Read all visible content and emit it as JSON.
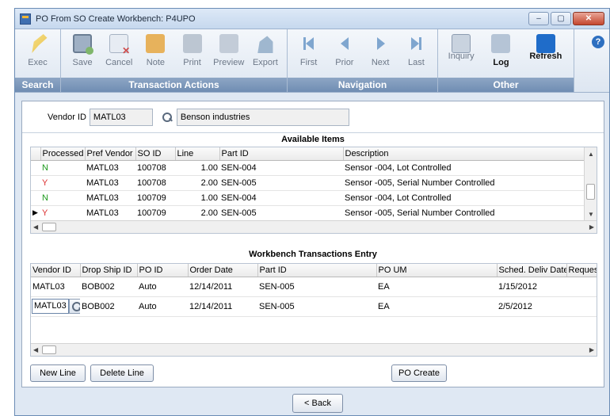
{
  "window": {
    "title": "PO From SO Create Workbench: P4UPO",
    "minimize": "–",
    "maximize": "▢",
    "close": "✕"
  },
  "ribbon": {
    "groups": [
      {
        "label": "Search",
        "tools": [
          {
            "label": "Exec",
            "icon": "exec-icon"
          }
        ]
      },
      {
        "label": "Transaction Actions",
        "tools": [
          {
            "label": "Save",
            "icon": "save-icon"
          },
          {
            "label": "Cancel",
            "icon": "cancel-icon"
          },
          {
            "label": "Note",
            "icon": "note-icon"
          },
          {
            "label": "Print",
            "icon": "print-icon"
          },
          {
            "label": "Preview",
            "icon": "preview-icon"
          },
          {
            "label": "Export",
            "icon": "export-icon"
          }
        ]
      },
      {
        "label": "Navigation",
        "tools": [
          {
            "label": "First",
            "icon": "first-icon"
          },
          {
            "label": "Prior",
            "icon": "prior-icon"
          },
          {
            "label": "Next",
            "icon": "next-icon"
          },
          {
            "label": "Last",
            "icon": "last-icon"
          }
        ]
      },
      {
        "label": "Other",
        "tools": [
          {
            "label": "Inquiry",
            "icon": "inquiry-icon"
          },
          {
            "label": "Log",
            "icon": "log-icon"
          },
          {
            "label": "Refresh",
            "icon": "refresh-icon"
          }
        ]
      }
    ],
    "help": "?"
  },
  "vendor": {
    "label": "Vendor ID",
    "id": "MATL03",
    "name": "Benson industries"
  },
  "available_items": {
    "title": "Available Items",
    "columns": [
      "Processed",
      "Pref Vendor",
      "SO ID",
      "Line",
      "Part ID",
      "Description"
    ],
    "rows": [
      {
        "processed": "N",
        "vendor": "MATL03",
        "so_id": "100708",
        "line": "1.00",
        "part": "SEN-004",
        "desc": "Sensor -004, Lot Controlled"
      },
      {
        "processed": "Y",
        "vendor": "MATL03",
        "so_id": "100708",
        "line": "2.00",
        "part": "SEN-005",
        "desc": "Sensor -005, Serial Number Controlled"
      },
      {
        "processed": "N",
        "vendor": "MATL03",
        "so_id": "100709",
        "line": "1.00",
        "part": "SEN-004",
        "desc": "Sensor -004, Lot Controlled"
      },
      {
        "processed": "Y",
        "vendor": "MATL03",
        "so_id": "100709",
        "line": "2.00",
        "part": "SEN-005",
        "desc": "Sensor -005, Serial Number Controlled"
      }
    ]
  },
  "workbench": {
    "title": "Workbench Transactions Entry",
    "columns": [
      "Vendor ID",
      "Drop Ship ID",
      "PO ID",
      "Order Date",
      "Part ID",
      "PO UM",
      "Sched. Deliv Date",
      "Request"
    ],
    "rows": [
      {
        "vendor": "MATL03",
        "drop_ship": "BOB002",
        "po_id": "Auto",
        "order_date": "12/14/2011",
        "part": "SEN-005",
        "um": "EA",
        "sched": "1/15/2012"
      },
      {
        "vendor": "MATL03",
        "drop_ship": "BOB002",
        "po_id": "Auto",
        "order_date": "12/14/2011",
        "part": "SEN-005",
        "um": "EA",
        "sched": "2/5/2012"
      }
    ]
  },
  "buttons": {
    "new_line": "New Line",
    "delete_line": "Delete Line",
    "po_create": "PO Create",
    "back": "< Back"
  }
}
